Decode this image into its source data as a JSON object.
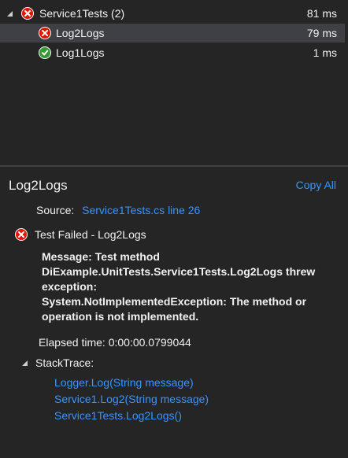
{
  "tree": {
    "group": {
      "label": "Service1Tests (2)",
      "duration": "81 ms",
      "status": "failed"
    },
    "tests": [
      {
        "label": "Log2Logs",
        "duration": "79 ms",
        "status": "failed",
        "selected": true
      },
      {
        "label": "Log1Logs",
        "duration": "1 ms",
        "status": "passed",
        "selected": false
      }
    ]
  },
  "details": {
    "title": "Log2Logs",
    "copy_all": "Copy All",
    "source_label": "Source:",
    "source_link": "Service1Tests.cs line 26",
    "status_text": "Test Failed - Log2Logs",
    "message_lines": [
      "Message: Test method",
      "DiExample.UnitTests.Service1Tests.Log2Logs threw",
      "exception:",
      "System.NotImplementedException: The method or",
      "operation is not implemented."
    ],
    "elapsed": "Elapsed time: 0:00:00.0799044",
    "stack_trace_label": "StackTrace:",
    "stack_frames": [
      "Logger.Log(String message)",
      "Service1.Log2(String message)",
      "Service1Tests.Log2Logs()"
    ]
  },
  "colors": {
    "background": "#252526",
    "selected_row": "#3f3f46",
    "link": "#3794ff",
    "fail": "#e51400",
    "pass": "#339933",
    "text": "#f1f1f1"
  }
}
